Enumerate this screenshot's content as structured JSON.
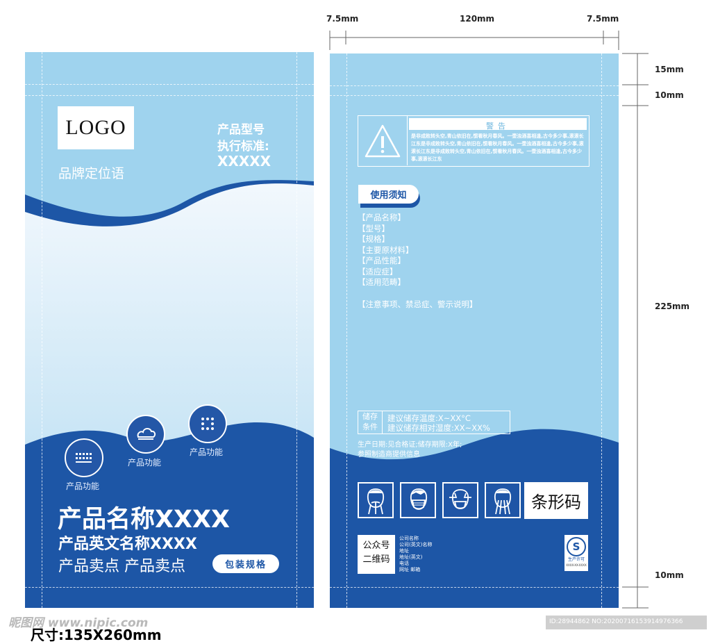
{
  "front": {
    "logo_text": "LOGO",
    "brand_slogan": "品牌定位语",
    "model_label": "产品型号",
    "standard_label": "执行标准:",
    "standard_value": "XXXXX",
    "features": [
      "产品功能",
      "产品功能",
      "产品功能"
    ],
    "product_name": "产品名称XXXX",
    "product_name_en": "产品英文名称XXXX",
    "selling_points": "产品卖点 产品卖点",
    "spec_button": "包装规格",
    "size_label": "尺寸:135X260mm",
    "colors": {
      "light": "#9fd3ee",
      "dark": "#1d56a6",
      "white_wave": "#f2f8fd"
    }
  },
  "back": {
    "warning_title": "警告",
    "warning_text": "是非成败转头空,青山依旧在,惯看秋月春风。一壶浊酒喜相逢,古今多少事,滚滚长江东是非成败转头空,青山依旧在,惯看秋月春风。一壶浊酒喜相逢,古今多少事,滚滚长江东是非成败转头空,青山依旧在,惯看秋月春风。一壶浊酒喜相逢,古今多少事,滚滚长江东",
    "instructions_tab": "使用须知",
    "fields": [
      "【产品名称】",
      "【型号】",
      "【规格】",
      "【主要原材料】",
      "【产品性能】",
      "【适应症】",
      "【适用范畴】"
    ],
    "notice": "【注意事项、禁忌症、警示说明】",
    "storage_label_1": "储存",
    "storage_label_2": "条件",
    "storage_temp": "建议储存温度:X~XX°C",
    "storage_humidity": "建议储存相对湿度:XX~XX%",
    "production_line": "生产日期:见合格证;储存期限:X年;",
    "production_line2": "参照制造商提供信息",
    "barcode_label": "条形码",
    "qr_label_1": "公众号",
    "qr_label_2": "二维码",
    "company_info": [
      "公司名称",
      "公司(英文)名称",
      "地址",
      "地址(英文)",
      "电话",
      "网址  邮箱"
    ],
    "qs_letter": "S",
    "qs_caption": "生产许可",
    "qs_code": "XXXX-XX-XXXX"
  },
  "dimensions": {
    "left_margin": "7.5mm",
    "width": "120mm",
    "right_margin": "7.5mm",
    "top_seal": "15mm",
    "second_seal": "10mm",
    "body_height": "225mm",
    "bottom_seal": "10mm"
  },
  "watermark": {
    "site": "昵图网 www.nipic.com",
    "id": "ID:28944862 NO:20200716153914976366"
  }
}
